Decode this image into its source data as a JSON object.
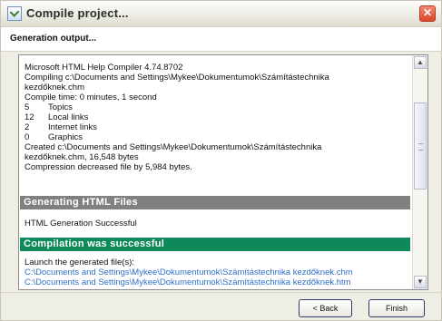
{
  "window": {
    "title": "Compile project...",
    "close_glyph": "✕"
  },
  "header": {
    "section_title": "Generation output..."
  },
  "log": {
    "lines": [
      "Microsoft HTML Help Compiler 4.74.8702",
      "Compiling c:\\Documents and Settings\\Mykee\\Dokumentumok\\Számítástechnika",
      "kezdőknek.chm",
      "Compile time: 0 minutes, 1 second"
    ],
    "stats": [
      {
        "num": "5",
        "label": "Topics"
      },
      {
        "num": "12",
        "label": "Local links"
      },
      {
        "num": "2",
        "label": "Internet links"
      },
      {
        "num": "0",
        "label": "Graphics"
      }
    ],
    "created_lines": [
      "Created c:\\Documents and Settings\\Mykee\\Dokumentumok\\Számítástechnika",
      "kezdőknek.chm, 16,548 bytes",
      "Compression decreased file by 5,984 bytes."
    ]
  },
  "sections": {
    "generating_title": "Generating HTML Files",
    "generating_result": "HTML Generation Successful",
    "compilation_title": "Compilation was successful",
    "launch_label": "Launch the generated file(s):",
    "links": [
      "C:\\Documents and Settings\\Mykee\\Dokumentumok\\Számítástechnika kezdőknek.chm",
      "C:\\Documents and Settings\\Mykee\\Dokumentumok\\Számítástechnika kezdőknek.htm"
    ]
  },
  "scrollbar": {
    "up_glyph": "▲",
    "down_glyph": "▼"
  },
  "buttons": {
    "back_label": "< Back",
    "finish_label": "Finish"
  },
  "colors": {
    "gray_bar": "#808080",
    "green_bar": "#0e8a5a",
    "link": "#2f6fc8"
  }
}
